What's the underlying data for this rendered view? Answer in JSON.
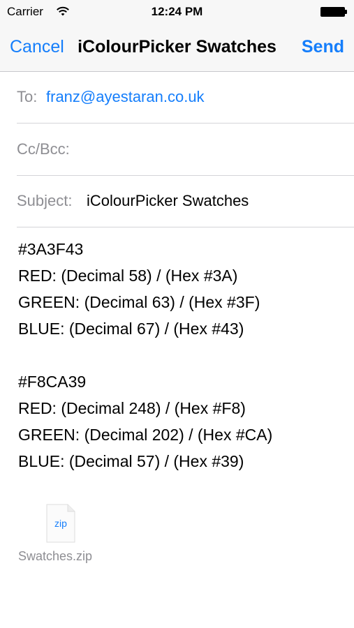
{
  "status": {
    "carrier": "Carrier",
    "time": "12:24 PM"
  },
  "nav": {
    "cancel": "Cancel",
    "title": "iColourPicker Swatches",
    "send": "Send"
  },
  "fields": {
    "to_label": "To:",
    "to_value": "franz@ayestaran.co.uk",
    "cc_label": "Cc/Bcc:",
    "subject_label": "Subject:",
    "subject_value": "iColourPicker Swatches"
  },
  "body": {
    "lines1": [
      "#3A3F43",
      "RED: (Decimal 58) / (Hex #3A)",
      "GREEN: (Decimal 63) / (Hex #3F)",
      "BLUE: (Decimal 67) / (Hex #43)"
    ],
    "lines2": [
      "#F8CA39",
      "RED: (Decimal 248) / (Hex #F8)",
      "GREEN: (Decimal 202) / (Hex #CA)",
      "BLUE: (Decimal 57) / (Hex #39)"
    ]
  },
  "attachment": {
    "icon_label": "zip",
    "name": "Swatches.zip"
  },
  "colors": {
    "accent": "#157efb",
    "gray": "#8e8e93"
  }
}
